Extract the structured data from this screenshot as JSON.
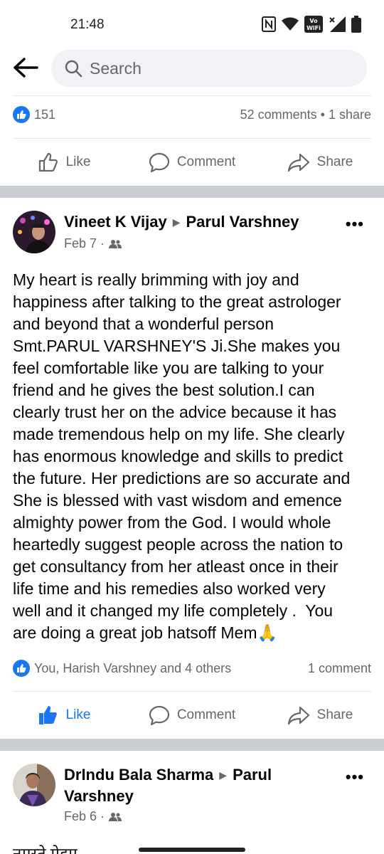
{
  "status_bar": {
    "time": "21:48",
    "volte_label": "Vo¹\nWiFi"
  },
  "search": {
    "placeholder": "Search"
  },
  "post1_footer": {
    "likes_count": "151",
    "comments_shares": "52 comments • 1 share",
    "like_label": "Like",
    "comment_label": "Comment",
    "share_label": "Share"
  },
  "post2": {
    "author": "Vineet K Vijay",
    "target": "Parul Varshney",
    "date": "Feb 7 ·",
    "more": "•••",
    "body": "My heart is really brimming with joy and\nhappiness after talking to the great astrologer\nand beyond that a wonderful person\nSmt.PARUL VARSHNEY'S Ji.She makes you\nfeel comfortable like you are talking to your\nfriend and he gives the best solution.I can\nclearly trust her on the advice because it has\nmade tremendous help on my life. She clearly\nhas enormous knowledge and skills to predict\nthe future. Her predictions are so accurate and\nShe is blessed with vast wisdom and emence\nalmighty power from the God. I would whole\nheartedly suggest people across the nation to\nget consultancy from her atleast once in their\nlife time and his remedies also worked very\nwell and it changed my life completely .  You\nare doing a great job hatsoff Mem🙏",
    "reactions": "You, Harish Varshney and 4 others",
    "comments": "1 comment",
    "like_label": "Like",
    "comment_label": "Comment",
    "share_label": "Share"
  },
  "post3": {
    "author": "DrIndu Bala Sharma",
    "target": "Parul",
    "target_line2": "Varshney",
    "date": "Feb 6 ·",
    "more": "•••",
    "body_peek": "नमस्ते मेडम"
  },
  "colors": {
    "accent": "#1877f2",
    "muted": "#65676b",
    "separator": "#c9ccd1"
  }
}
